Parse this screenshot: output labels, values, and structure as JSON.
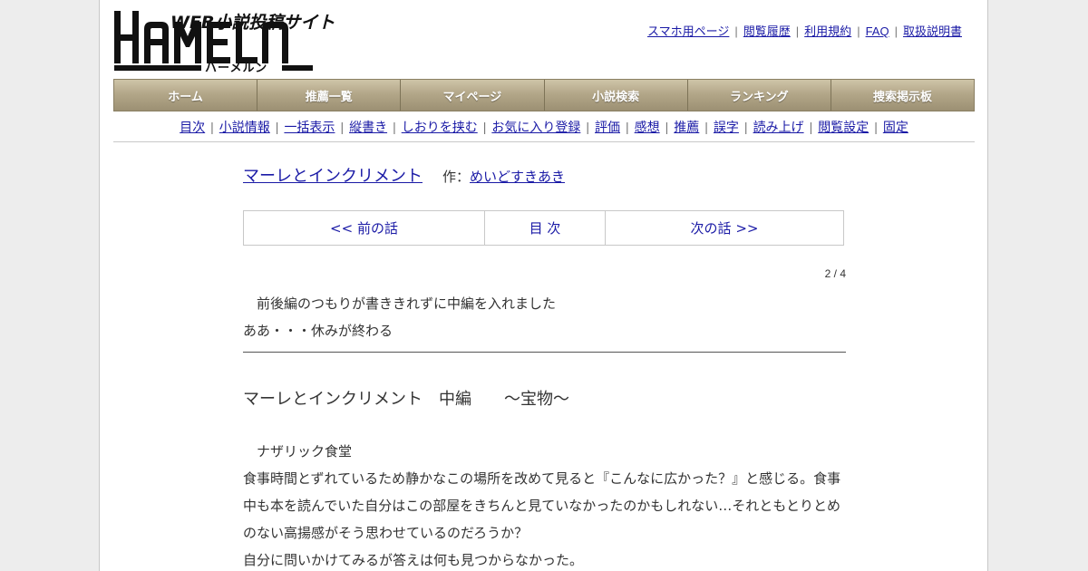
{
  "logo": {
    "tagline": "WEB小説投稿サイト",
    "name": "HAMELN",
    "kana": "ハーメルン"
  },
  "top_links": [
    "スマホ用ページ",
    "閲覧履歴",
    "利用規約",
    "FAQ",
    "取扱説明書"
  ],
  "main_nav": [
    "ホーム",
    "推薦一覧",
    "マイページ",
    "小説検索",
    "ランキング",
    "捜索掲示板"
  ],
  "sub_nav": [
    "目次",
    "小説情報",
    "一括表示",
    "縦書き",
    "しおりを挟む",
    "お気に入り登録",
    "評価",
    "感想",
    "推薦",
    "誤字",
    "読み上げ",
    "閲覧設定",
    "固定"
  ],
  "novel": {
    "title": "マーレとインクリメント",
    "author_prefix": "作：",
    "author": "めいどすきあき"
  },
  "chapter_nav": {
    "prev": "<< 前の話",
    "toc": "目 次",
    "next": "次の話 >>"
  },
  "page_count": "2 / 4",
  "preface": [
    "　前後編のつもりが書ききれずに中編を入れました",
    "ああ・・・休みが終わる"
  ],
  "chapter_title": "マーレとインクリメント　中編　　～宝物～",
  "body": [
    "　ナザリック食堂",
    "食事時間とずれているため静かなこの場所を改めて見ると『こんなに広かった？』と感じる。食事",
    "中も本を読んでいた自分はこの部屋をきちんと見ていなかったのかもしれない…それともとりとめ",
    "のない高揚感がそう思わせているのだろうか？",
    "自分に問いかけてみるが答えは何も見つからなかった。"
  ]
}
